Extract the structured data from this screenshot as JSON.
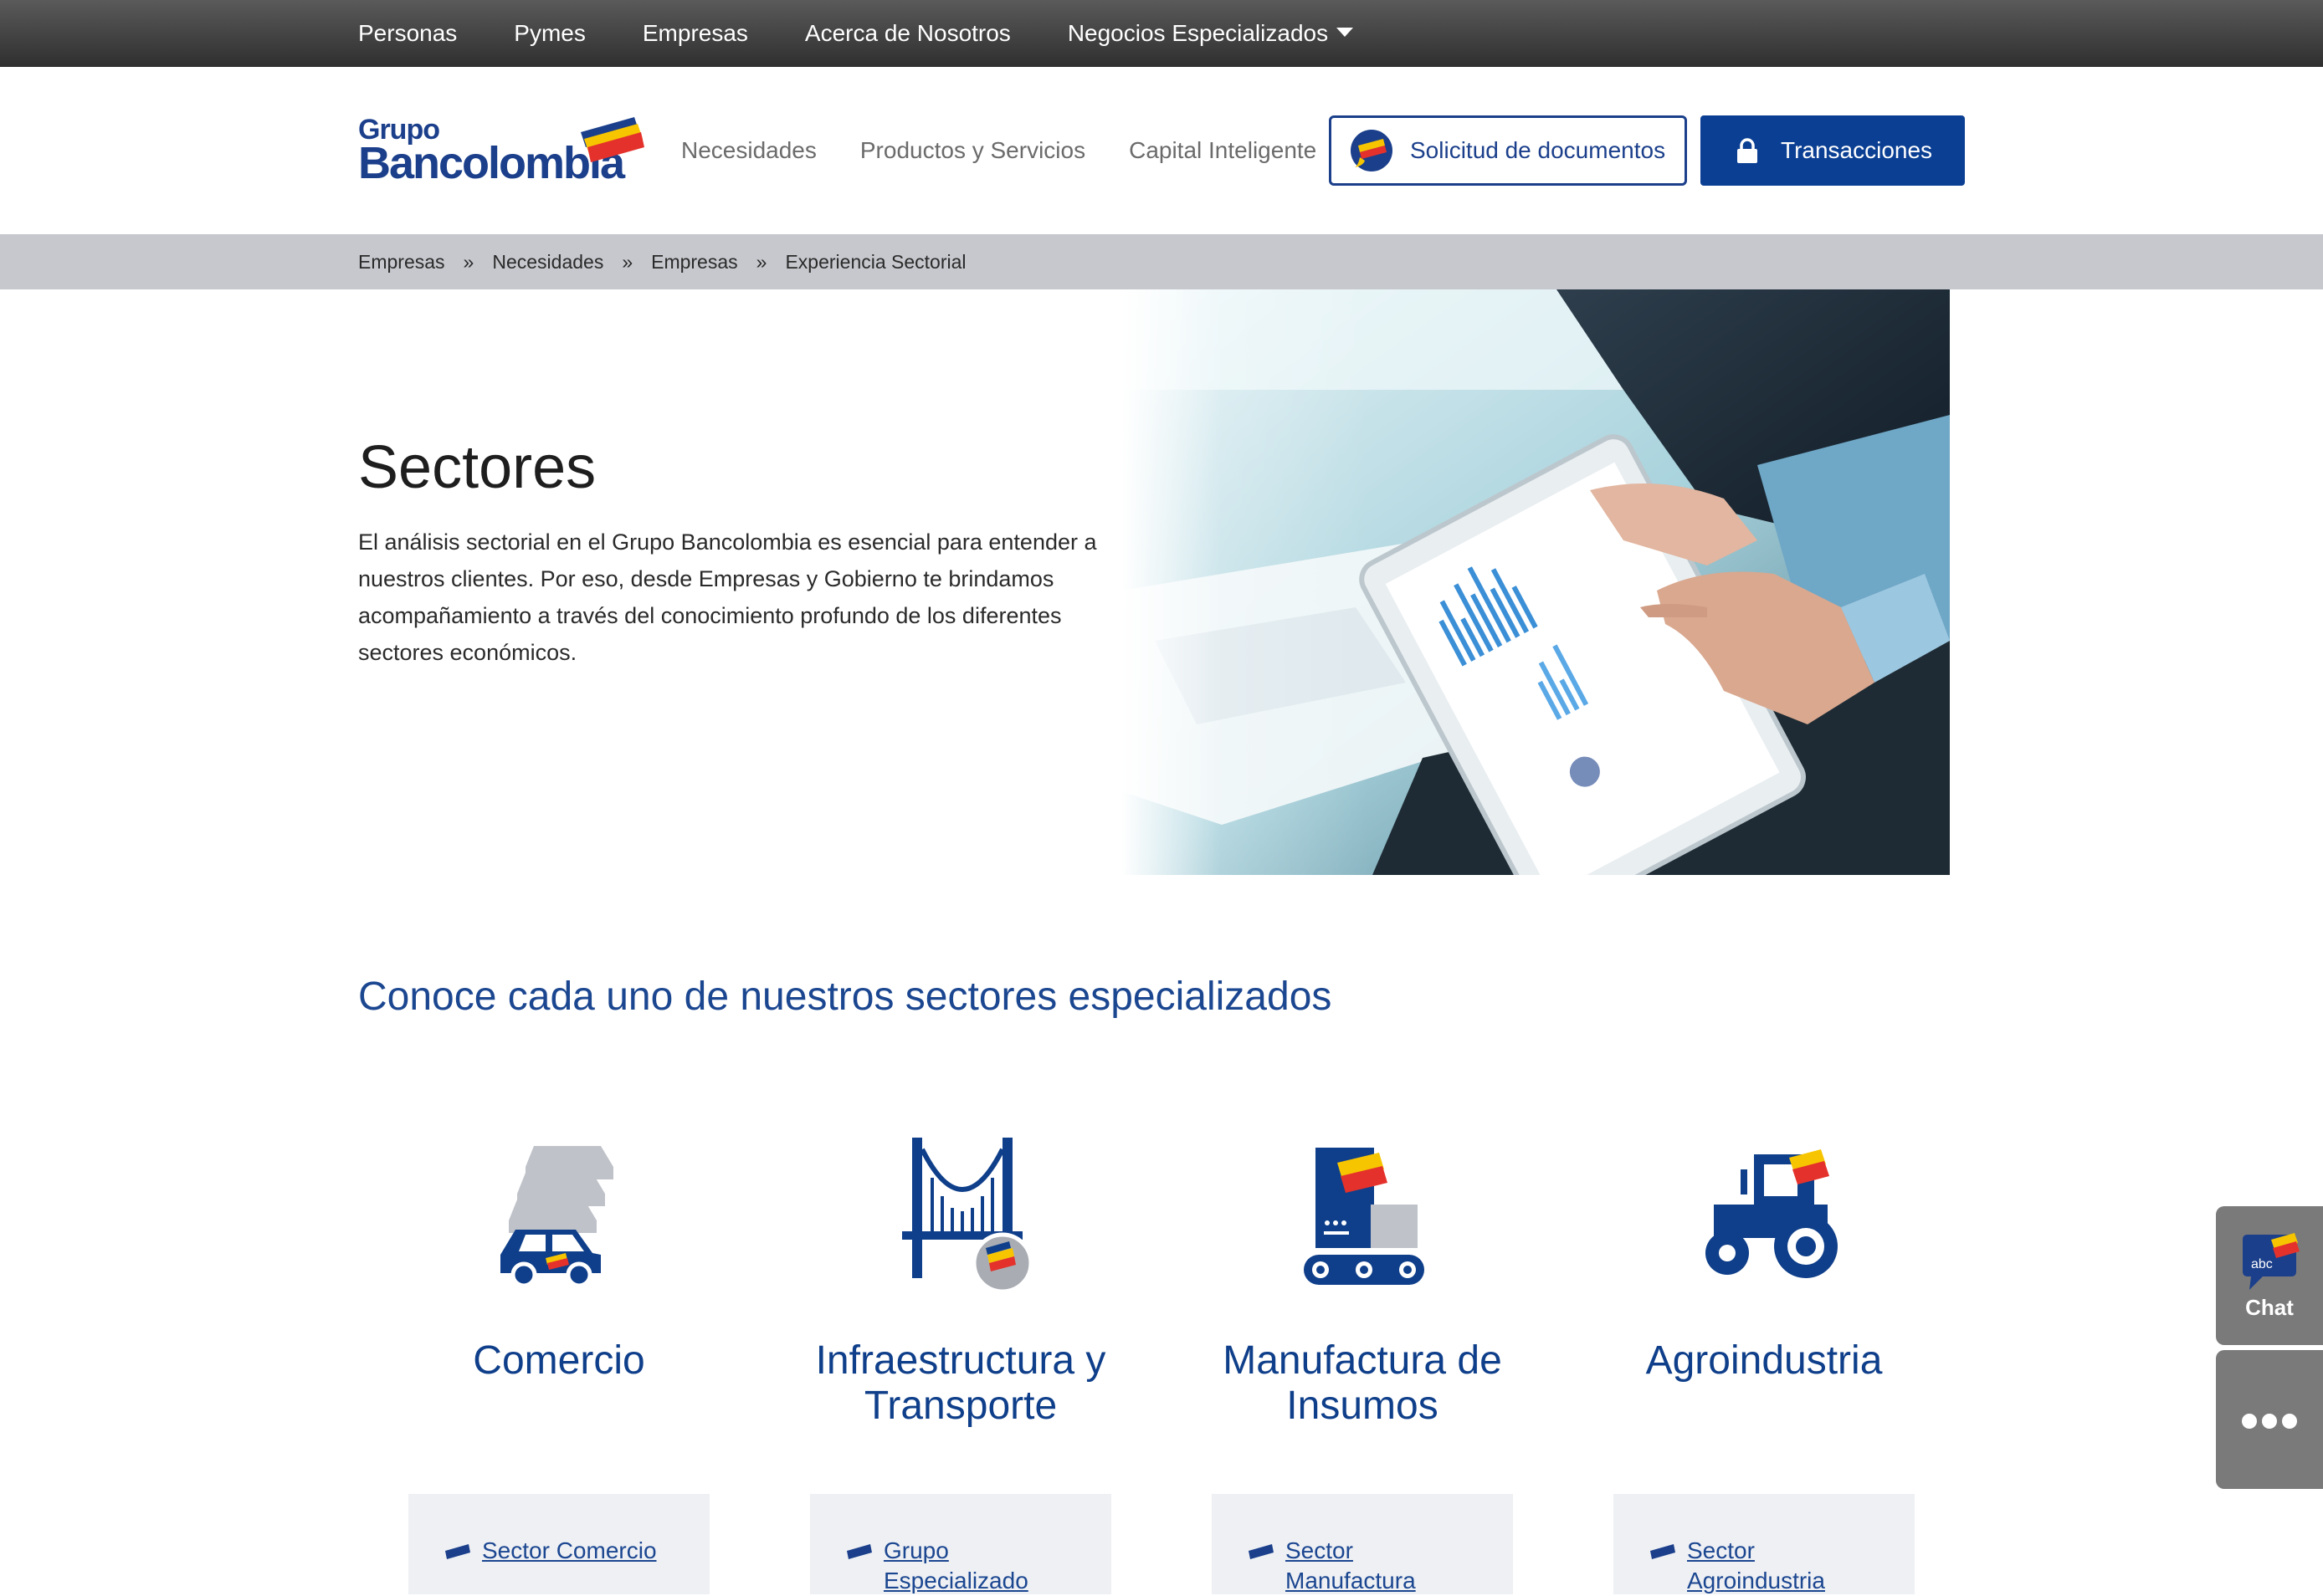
{
  "topnav": {
    "items": [
      "Personas",
      "Pymes",
      "Empresas",
      "Acerca de Nosotros",
      "Negocios Especializados"
    ]
  },
  "logo": {
    "line1": "Grupo",
    "line2": "Bancolombia"
  },
  "mainnav": {
    "items": [
      "Necesidades",
      "Productos y Servicios",
      "Capital Inteligente"
    ]
  },
  "buttons": {
    "solicitud": "Solicitud de documentos",
    "transacciones": "Transacciones"
  },
  "breadcrumb": {
    "items": [
      "Empresas",
      "Necesidades",
      "Empresas",
      "Experiencia Sectorial"
    ],
    "separator": "»"
  },
  "hero": {
    "title": "Sectores",
    "text": "El análisis sectorial en el Grupo Bancolombia es esencial para entender a nuestros clientes. Por eso, desde Empresas y Gobierno te brindamos acompañamiento a través del conocimiento profundo de los diferentes sectores económicos."
  },
  "sectors": {
    "heading": "Conoce cada uno de nuestros sectores especializados",
    "cards": [
      {
        "title": "Comercio",
        "icon": "cars-icon",
        "link": "Sector Comercio"
      },
      {
        "title": "Infraestructura y Transporte",
        "icon": "bridge-icon",
        "link": "Grupo Especializado"
      },
      {
        "title": "Manufactura de Insumos",
        "icon": "factory-machine-icon",
        "link": "Sector Manufactura"
      },
      {
        "title": "Agroindustria",
        "icon": "tractor-icon",
        "link": "Sector Agroindustria"
      }
    ]
  },
  "side": {
    "chat_badge": "abc",
    "chat_label": "Chat",
    "more_icon": "more-dots-icon"
  },
  "colors": {
    "brand_blue": "#0b3f93",
    "heading_blue": "#1b4690",
    "brand_yellow": "#f7c500",
    "brand_red": "#e4312b",
    "breadcrumb_bg": "#c6c8cd",
    "topbar_bg": "#3a3a3a"
  }
}
